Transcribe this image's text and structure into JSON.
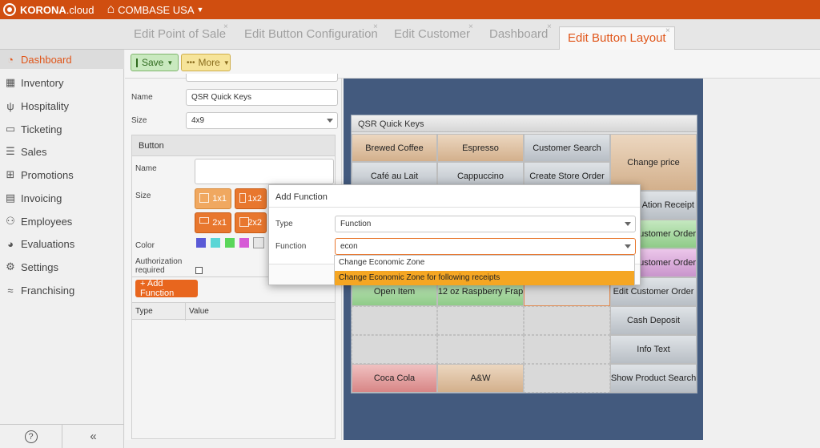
{
  "app": {
    "logo_text": "KORONA",
    "logo_suffix": ".cloud",
    "org_name": "COMBASE USA"
  },
  "tabs": [
    {
      "label": "Edit Point of Sale",
      "active": false
    },
    {
      "label": "Edit Button Configuration",
      "active": false
    },
    {
      "label": "Edit Customer",
      "active": false
    },
    {
      "label": "Dashboard",
      "active": false
    },
    {
      "label": "Edit Button Layout",
      "active": true
    }
  ],
  "tab_close_glyph": "×",
  "sidebar": {
    "items": [
      {
        "label": "Dashboard",
        "icon": "speedometer-icon",
        "active": true
      },
      {
        "label": "Inventory",
        "icon": "boxes-icon"
      },
      {
        "label": "Hospitality",
        "icon": "cutlery-icon"
      },
      {
        "label": "Ticketing",
        "icon": "ticket-icon"
      },
      {
        "label": "Sales",
        "icon": "receipt-icon"
      },
      {
        "label": "Promotions",
        "icon": "gift-icon"
      },
      {
        "label": "Invoicing",
        "icon": "invoice-icon"
      },
      {
        "label": "Employees",
        "icon": "people-icon"
      },
      {
        "label": "Evaluations",
        "icon": "pie-chart-icon"
      },
      {
        "label": "Settings",
        "icon": "gear-icon"
      },
      {
        "label": "Franchising",
        "icon": "handshake-icon"
      }
    ],
    "help_glyph": "?",
    "collapse_glyph": "«"
  },
  "toolbar": {
    "save_label": "Save",
    "more_label": "More"
  },
  "props": {
    "name_label": "Name",
    "name_value": "QSR Quick Keys",
    "size_label": "Size",
    "size_value": "4x9",
    "button_section_title": "Button",
    "button_name_label": "Name",
    "button_name_value": "",
    "button_size_label": "Size",
    "size_options": [
      "1x1",
      "1x2",
      "2x1",
      "2x2"
    ],
    "color_label": "Color",
    "colors": [
      "#5a5ad6",
      "#5ad6d6",
      "#5ad65a",
      "#d65ad6",
      "#e6e6e6"
    ],
    "auth_label_1": "Authorization",
    "auth_label_2": "required",
    "add_function_label": "+ Add Function",
    "table_col_type": "Type",
    "table_col_value": "Value"
  },
  "layout_grid": {
    "title": "QSR Quick Keys",
    "cells": {
      "r0c0": "Brewed Coffee",
      "r0c1": "Espresso",
      "r0c2": "Customer Search",
      "r0c3": "Change price",
      "r1c0": "Café au Lait",
      "r1c1": "Cappuccino",
      "r1c2": "Create Store Order",
      "r2c3": "Reprint Ation Receipt",
      "r3c3": "Create Customer Order",
      "r4c3": "Create Customer Order",
      "r5c0": "Open Item",
      "r5c1": "12 oz Raspberry Frap",
      "r5c3": "Edit Customer Order",
      "r6c3": "Cash Deposit",
      "r7c3": "Info Text",
      "r8c0": "Coca Cola",
      "r8c1": "A&W",
      "r8c3": "Show Product Search"
    }
  },
  "modal": {
    "title": "Add Function",
    "type_label": "Type",
    "type_value": "Function",
    "function_label": "Function",
    "function_value": "econ",
    "options": [
      {
        "label": "Change Economic Zone",
        "highlighted": false
      },
      {
        "label": "Change Economic Zone for following receipts",
        "highlighted": true
      }
    ]
  }
}
